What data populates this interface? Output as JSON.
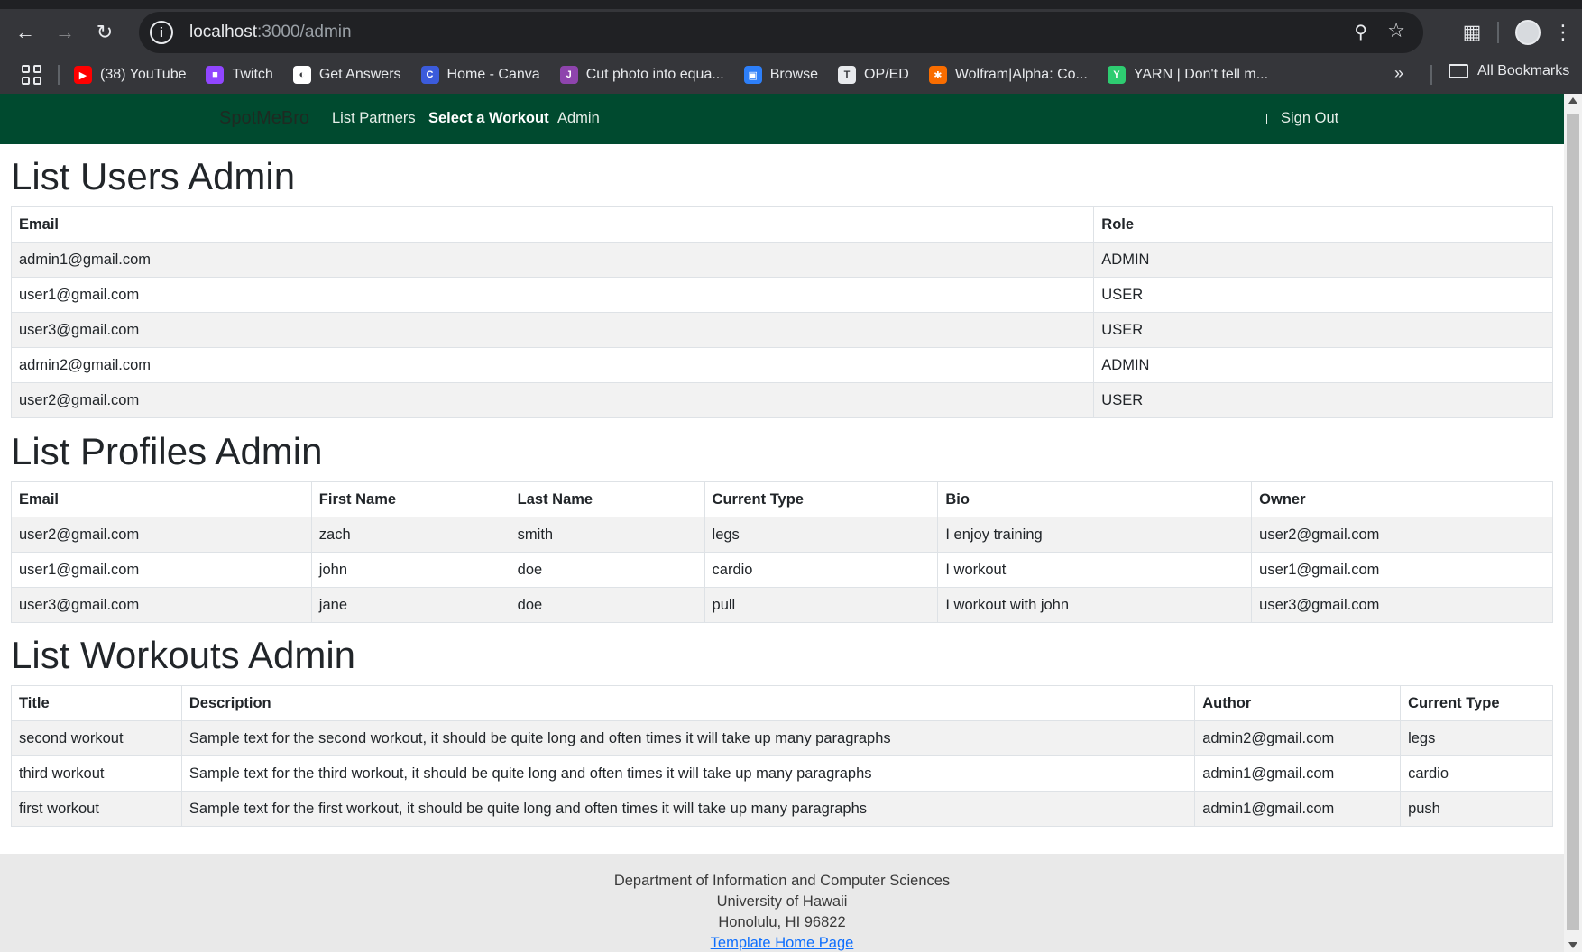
{
  "browser": {
    "url_host": "localhost",
    "url_path": ":3000/admin",
    "bookmarks": [
      {
        "label": "(38) YouTube",
        "icon": "youtube-icon",
        "color": "#ff0000"
      },
      {
        "label": "Twitch",
        "icon": "twitch-icon",
        "color": "#9146ff"
      },
      {
        "label": "Get Answers",
        "icon": "get-answers-icon",
        "color": "#ffffff"
      },
      {
        "label": "Home - Canva",
        "icon": "canva-icon",
        "color": "#3b5bdb"
      },
      {
        "label": "Cut photo into equa...",
        "icon": "jpg-icon",
        "color": "#8e44ad"
      },
      {
        "label": "Browse",
        "icon": "browse-icon",
        "color": "#2d7ff9"
      },
      {
        "label": "OP/ED",
        "icon": "oped-icon",
        "color": "#e8eaed"
      },
      {
        "label": "Wolfram|Alpha: Co...",
        "icon": "wolfram-icon",
        "color": "#f96d00"
      },
      {
        "label": "YARN | Don't tell m...",
        "icon": "yarn-icon",
        "color": "#2ecc71"
      }
    ],
    "all_bookmarks": "All Bookmarks"
  },
  "nav": {
    "brand": "SpotMeBro",
    "links": [
      "List Partners",
      "Select a Workout",
      "Admin"
    ],
    "active": "Select a Workout",
    "sign_out": "Sign Out",
    "bg_color": "#004a2f"
  },
  "users": {
    "title": "List Users Admin",
    "columns": [
      "Email",
      "Role"
    ],
    "rows": [
      [
        "admin1@gmail.com",
        "ADMIN"
      ],
      [
        "user1@gmail.com",
        "USER"
      ],
      [
        "user3@gmail.com",
        "USER"
      ],
      [
        "admin2@gmail.com",
        "ADMIN"
      ],
      [
        "user2@gmail.com",
        "USER"
      ]
    ]
  },
  "profiles": {
    "title": "List Profiles Admin",
    "columns": [
      "Email",
      "First Name",
      "Last Name",
      "Current Type",
      "Bio",
      "Owner"
    ],
    "rows": [
      [
        "user2@gmail.com",
        "zach",
        "smith",
        "legs",
        "I enjoy training",
        "user2@gmail.com"
      ],
      [
        "user1@gmail.com",
        "john",
        "doe",
        "cardio",
        "I workout",
        "user1@gmail.com"
      ],
      [
        "user3@gmail.com",
        "jane",
        "doe",
        "pull",
        "I workout with john",
        "user3@gmail.com"
      ]
    ]
  },
  "workouts": {
    "title": "List Workouts Admin",
    "columns": [
      "Title",
      "Description",
      "Author",
      "Current Type"
    ],
    "rows": [
      [
        "second workout",
        "Sample text for the second workout, it should be quite long and often times it will take up many paragraphs",
        "admin2@gmail.com",
        "legs"
      ],
      [
        "third workout",
        "Sample text for the third workout, it should be quite long and often times it will take up many paragraphs",
        "admin1@gmail.com",
        "cardio"
      ],
      [
        "first workout",
        "Sample text for the first workout, it should be quite long and often times it will take up many paragraphs",
        "admin1@gmail.com",
        "push"
      ]
    ]
  },
  "footer": {
    "line1": "Department of Information and Computer Sciences",
    "line2": "University of Hawaii",
    "line3": "Honolulu, HI 96822",
    "link": "Template Home Page"
  }
}
